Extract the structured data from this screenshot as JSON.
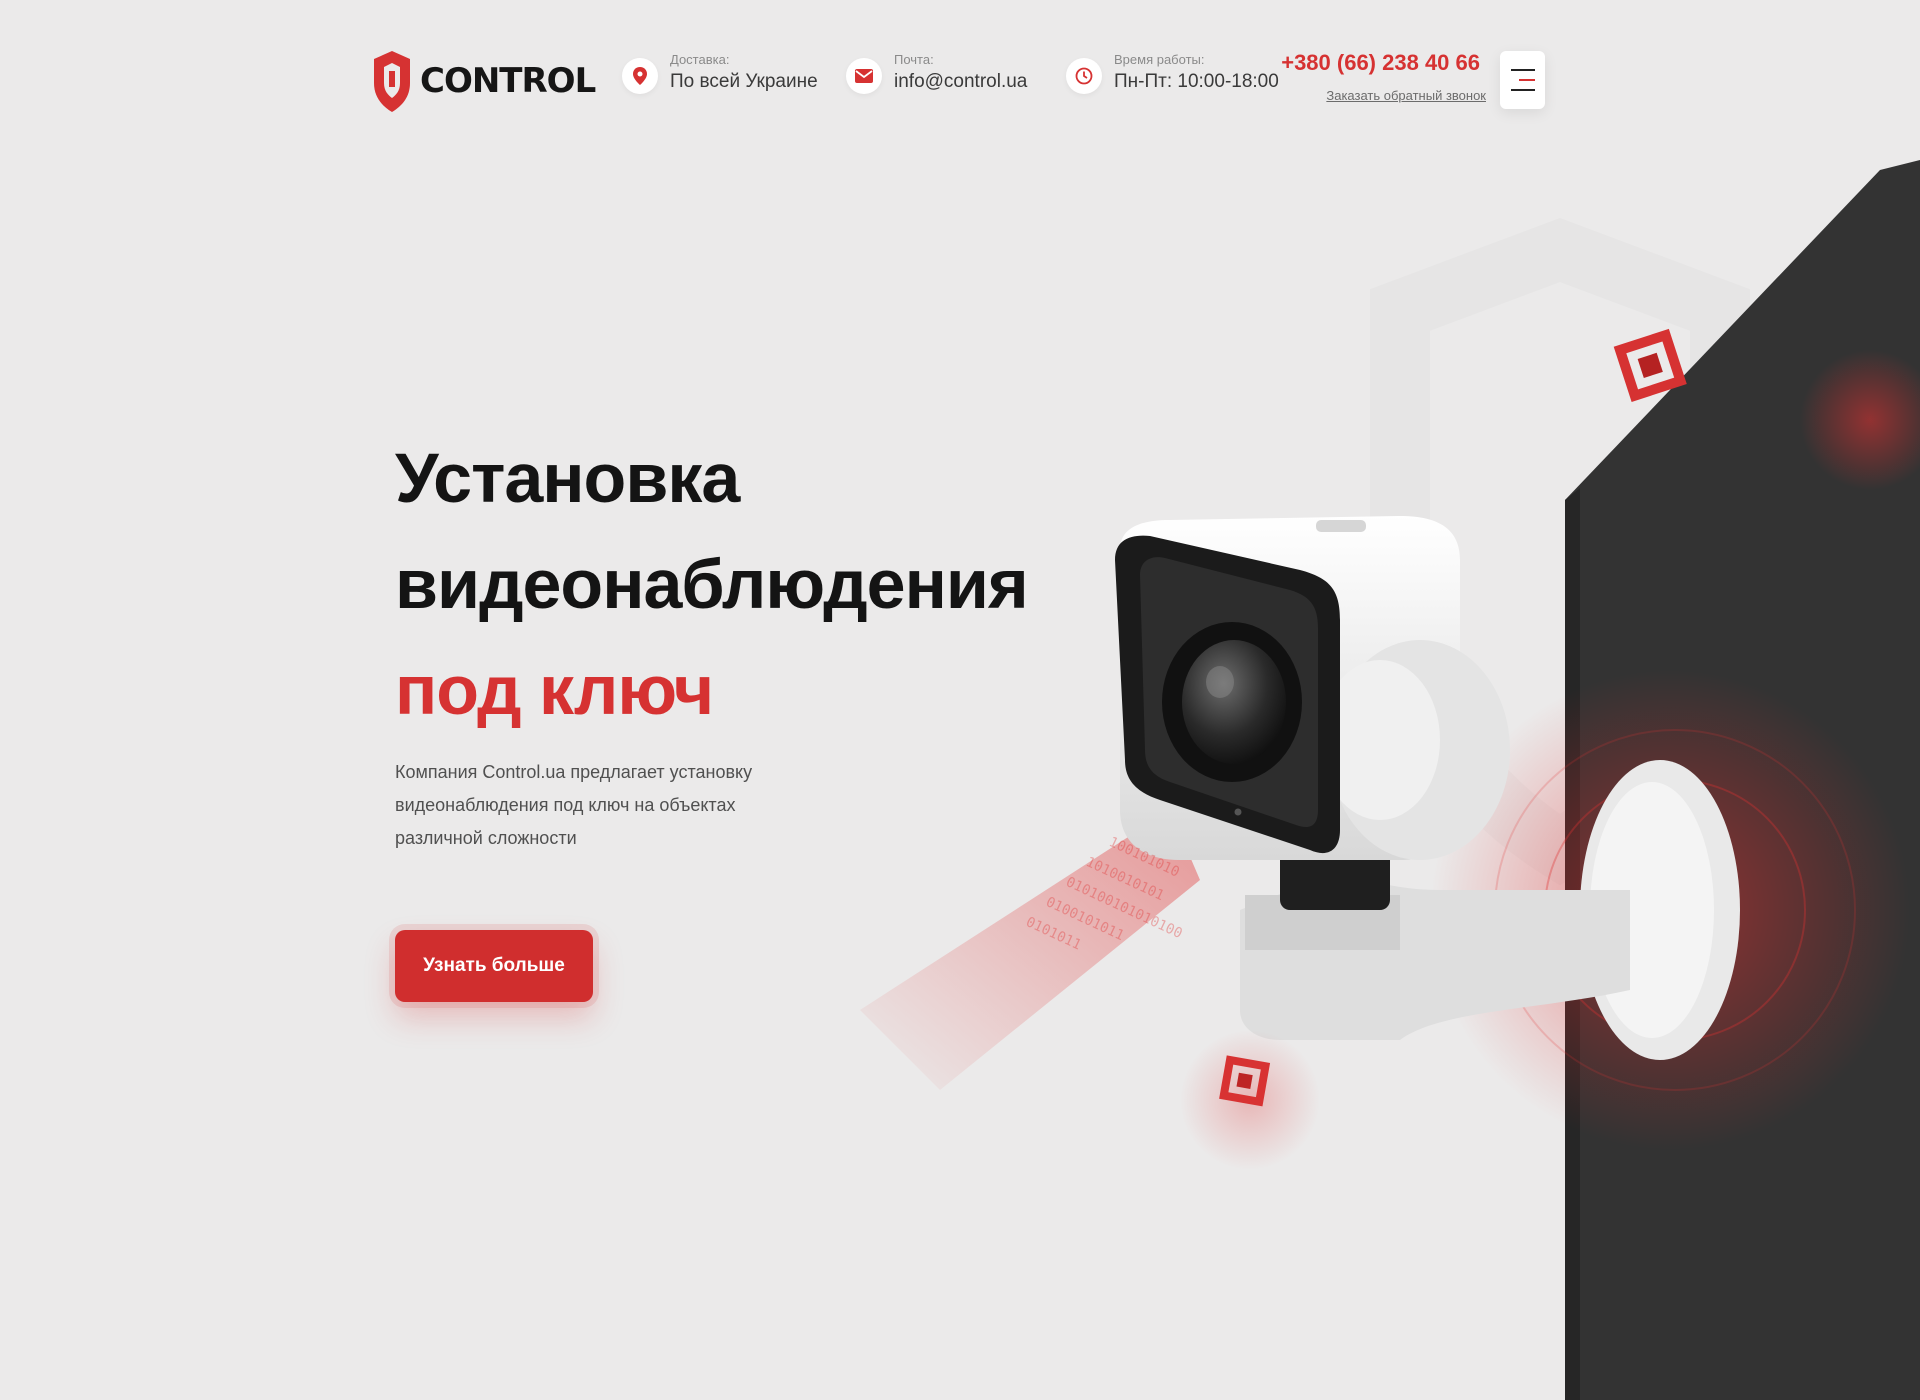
{
  "header": {
    "logo_text": "CONTROL",
    "delivery": {
      "label": "Доставка:",
      "value": "По всей Украине",
      "icon": "location-pin-icon"
    },
    "email": {
      "label": "Почта:",
      "value": "info@control.ua",
      "icon": "envelope-icon"
    },
    "hours": {
      "label": "Время работы:",
      "value": "Пн-Пт: 10:00-18:00",
      "icon": "clock-icon"
    },
    "phone": "+380 (66) 238 40 66",
    "callback_link": "Заказать обратный звонок",
    "menu_icon": "hamburger-menu-icon"
  },
  "hero": {
    "title_line1": "Установка",
    "title_line2": "видеонаблюдения",
    "title_accent": "под ключ",
    "description": "Компания Control.ua предлагает установку видеонаблюдения под ключ на объектах различной сложности",
    "cta_label": "Узнать больше"
  },
  "colors": {
    "accent": "#d63232",
    "background": "#ebeaea",
    "wall": "#2e2e2e",
    "text": "#141414"
  }
}
